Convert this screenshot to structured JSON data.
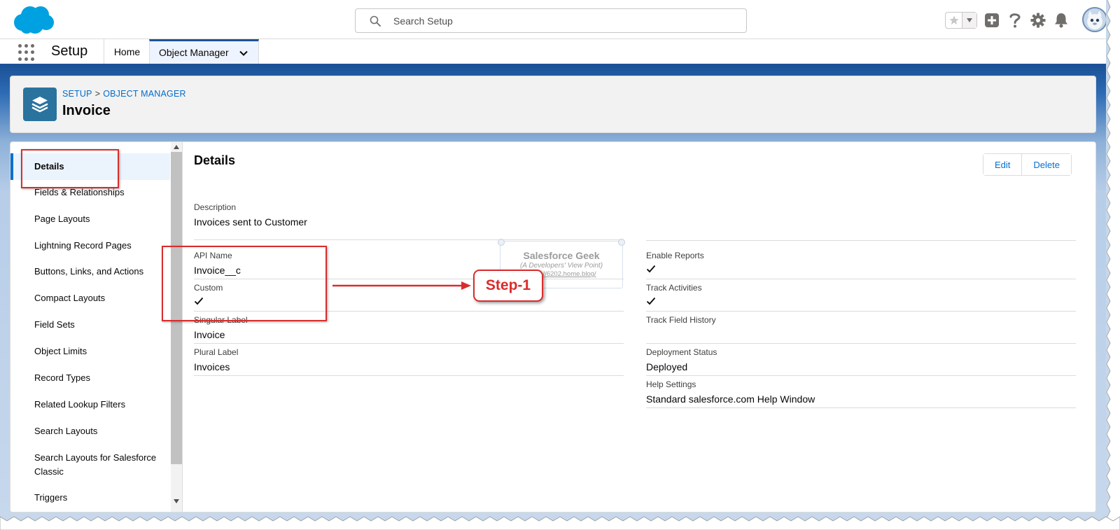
{
  "header": {
    "search_placeholder": "Search Setup",
    "icons": [
      "star-icon",
      "chevron-down-icon",
      "add-icon",
      "help-icon",
      "gear-icon",
      "bell-icon",
      "avatar"
    ]
  },
  "context_bar": {
    "app_name": "Setup",
    "tabs": [
      {
        "label": "Home"
      },
      {
        "label": "Object Manager",
        "active": true
      }
    ]
  },
  "page_header": {
    "breadcrumb": [
      "SETUP",
      "OBJECT MANAGER"
    ],
    "breadcrumb_sep": ">",
    "title": "Invoice"
  },
  "sidebar": {
    "items": [
      {
        "label": "Details",
        "active": true
      },
      {
        "label": "Fields & Relationships"
      },
      {
        "label": "Page Layouts"
      },
      {
        "label": "Lightning Record Pages"
      },
      {
        "label": "Buttons, Links, and Actions"
      },
      {
        "label": "Compact Layouts"
      },
      {
        "label": "Field Sets"
      },
      {
        "label": "Object Limits"
      },
      {
        "label": "Record Types"
      },
      {
        "label": "Related Lookup Filters"
      },
      {
        "label": "Search Layouts"
      },
      {
        "label": "Search Layouts for Salesforce Classic"
      },
      {
        "label": "Triggers"
      }
    ]
  },
  "details": {
    "title": "Details",
    "buttons": {
      "edit": "Edit",
      "delete": "Delete"
    },
    "description": {
      "label": "Description",
      "value": "Invoices sent to Customer"
    },
    "left": {
      "api_name": {
        "label": "API Name",
        "value": "Invoice__c"
      },
      "custom": {
        "label": "Custom",
        "checked": true
      },
      "singular_label": {
        "label": "Singular Label",
        "value": "Invoice"
      },
      "plural_label": {
        "label": "Plural Label",
        "value": "Invoices"
      }
    },
    "right": {
      "enable_reports": {
        "label": "Enable Reports",
        "checked": true
      },
      "track_activities": {
        "label": "Track Activities",
        "checked": true
      },
      "track_field_history": {
        "label": "Track Field History",
        "checked": false
      },
      "deployment_status": {
        "label": "Deployment Status",
        "value": "Deployed"
      },
      "help_settings": {
        "label": "Help Settings",
        "value": "Standard salesforce.com Help Window"
      }
    }
  },
  "annotation": {
    "step_label": "Step-1",
    "color": "#d92d2d"
  },
  "watermark": {
    "title": "Salesforce Geek",
    "subtitle": "(A Developers' View Point)",
    "url": "https://6202.home.blog/"
  },
  "colors": {
    "brand_blue": "#1b5297",
    "link_blue": "#0070d2",
    "object_icon": "#2a739e",
    "salesforce_cloud": "#00a1e0"
  }
}
